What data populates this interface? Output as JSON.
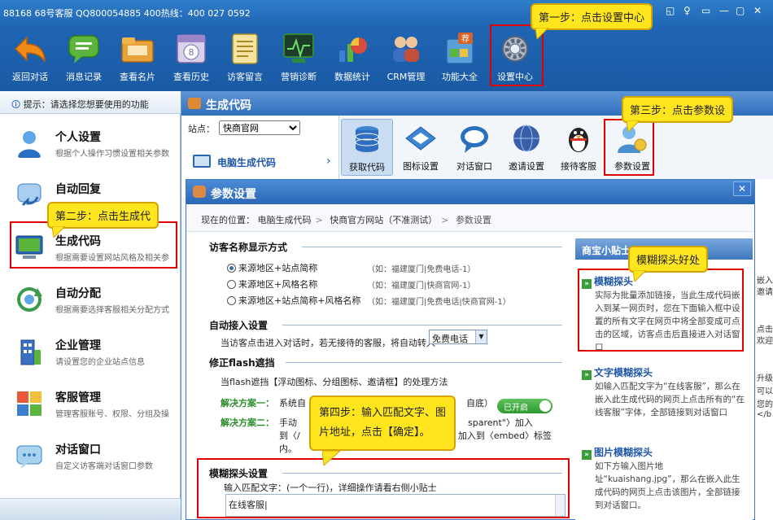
{
  "titlebar": {
    "text": "88168 68号客服 QQ800054885   400热线：400 027 0592",
    "controls": [
      "◱",
      "♀",
      "▭",
      "—",
      "▢",
      "✕"
    ]
  },
  "toolbar": [
    {
      "label": "返回对话",
      "icon": "back-arrow-icon",
      "color": "#f08a1a"
    },
    {
      "label": "消息记录",
      "icon": "message-bubble-icon",
      "color": "#5bb53a"
    },
    {
      "label": "查看名片",
      "icon": "folder-card-icon",
      "color": "#e8a23a"
    },
    {
      "label": "查看历史",
      "icon": "history-calendar-icon",
      "color": "#9a85c8"
    },
    {
      "label": "访客留言",
      "icon": "notepad-icon",
      "color": "#e3c36a"
    },
    {
      "label": "营销诊断",
      "icon": "stethoscope-icon",
      "color": "#2f8a3a"
    },
    {
      "label": "数据统计",
      "icon": "pie-chart-icon",
      "color": "#d94b3a"
    },
    {
      "label": "CRM管理",
      "icon": "users-icon",
      "color": "#3a6fc4"
    },
    {
      "label": "功能大全",
      "icon": "recommend-box-icon",
      "color": "#d9622a"
    },
    {
      "label": "设置中心",
      "icon": "gear-icon",
      "color": "#8a97a8"
    }
  ],
  "callouts": {
    "step1": "第一步：点击设置中心",
    "step2": "第二步：点击生成代",
    "step3": "第三步：点击参数设",
    "step4_line1": "第四步：输入匹配文字、图",
    "step4_line2": "片地址，点击【确定】。",
    "fuzzy": "模糊探头好处"
  },
  "leftpanel": {
    "hint": "提示：请选择您想要使用的功能",
    "items": [
      {
        "title": "个人设置",
        "desc": "根据个人操作习惯设置相关参数",
        "icon": "person-icon",
        "color": "#3a7fd0"
      },
      {
        "title": "自动回复",
        "desc": "",
        "icon": "reply-icon",
        "color": "#5aa0d8"
      },
      {
        "title": "生成代码",
        "desc": "根据需要设置网站风格及相关参",
        "icon": "monitor-code-icon",
        "color": "#2a66b8"
      },
      {
        "title": "自动分配",
        "desc": "根据需要选择客服相关分配方式",
        "icon": "refresh-dispatch-icon",
        "color": "#3a9a4a"
      },
      {
        "title": "企业管理",
        "desc": "请设置您的企业站点信息",
        "icon": "building-icon",
        "color": "#3a6fc4"
      },
      {
        "title": "客服管理",
        "desc": "管理客服账号、权限、分组及操",
        "icon": "grid-colors-icon",
        "color": "#e85a3a"
      },
      {
        "title": "对话窗口",
        "desc": "自定义访客端对话窗口参数",
        "icon": "chat-window-icon",
        "color": "#6ab0e0"
      }
    ]
  },
  "genwin": {
    "title": "生成代码",
    "site_label": "站点：",
    "site_value": "快商官网",
    "pc_label": "电脑生成代码",
    "tools": [
      {
        "label": "获取代码",
        "icon": "database-icon",
        "color": "#2f6ec0"
      },
      {
        "label": "图标设置",
        "icon": "monitor-settings-icon",
        "color": "#3d86d4"
      },
      {
        "label": "对话窗口",
        "icon": "speech-bubble-icon",
        "color": "#2a6fbd"
      },
      {
        "label": "邀请设置",
        "icon": "globe-icon",
        "color": "#3a5fa8"
      },
      {
        "label": "接待客服",
        "icon": "penguin-icon",
        "color": "#222222"
      },
      {
        "label": "参数设置",
        "icon": "user-settings-icon",
        "color": "#5aa0d8"
      }
    ]
  },
  "dialog": {
    "title": "参数设置",
    "close": "✕",
    "crumb": {
      "label": "现在的位置：",
      "parts": [
        "电脑生成代码",
        "快商官方网站（不准测试）",
        "参数设置"
      ]
    },
    "visitor_section": "访客名称显示方式",
    "radios": [
      {
        "label": "来源地区+站点简称",
        "example": "（如：福建厦门|免费电话-1）",
        "checked": true
      },
      {
        "label": "来源地区+风格名称",
        "example": "（如：福建厦门|快商官网-1）",
        "checked": false
      },
      {
        "label": "来源地区+站点简称+风格名称",
        "example": "（如：福建厦门|免费电话|快商官网-1）",
        "checked": false
      }
    ],
    "auto_section": "自动接入设置",
    "auto_text": "当访客点击进入对话时，若无接待的客服，将自动转入",
    "auto_select": "免费电话",
    "flash_section": "修正flash遮挡",
    "flash_text": "当flash遮挡【浮动图标、分组图标、邀请框】的处理方法",
    "sol1_label": "解决方案一：",
    "sol1_text": "系统自",
    "sol1_tail": "自底）",
    "toggle": "已开启",
    "sol2_label": "解决方案二：",
    "sol2_text": "手动",
    "sol2_tail": "sparent\"〉加入",
    "sol2_line2": "到〈/",
    "sol2_line2_tail": "nt\" 加入到〈embed〉标签",
    "sol2_line3": "内。",
    "fuzzy_section": "模糊探头设置",
    "fuzzy_text": "输入匹配文字：(一个一行)，详细操作请看右侧小贴士",
    "fuzzy_value": "在线客服|"
  },
  "tips": {
    "header": "商宝小贴士",
    "items": [
      {
        "title": "模糊探头",
        "body": "实际为批量添加链接，当此生成代码嵌入到某一网页时，您在下面输入框中设置的所有文字在网页中将全部变成可点击的区域，访客点击后直接进入对话窗口"
      },
      {
        "title": "文字模糊探头",
        "body": "如输入匹配文字为“在线客服”，那么在嵌入此生成代码的网页上点击所有的“在线客服”字体，全部链接到对话窗口"
      },
      {
        "title": "图片模糊探头",
        "body": "如下方输入图片地址“kuaishang.jpg”，那么在嵌入此生成代码的网页上点击该图片，全部链接到对话窗口。"
      }
    ]
  },
  "farright": [
    "嵌入",
    "邀请",
    "点击",
    "欢迎",
    "升级",
    "可以",
    "您的",
    "</b"
  ]
}
